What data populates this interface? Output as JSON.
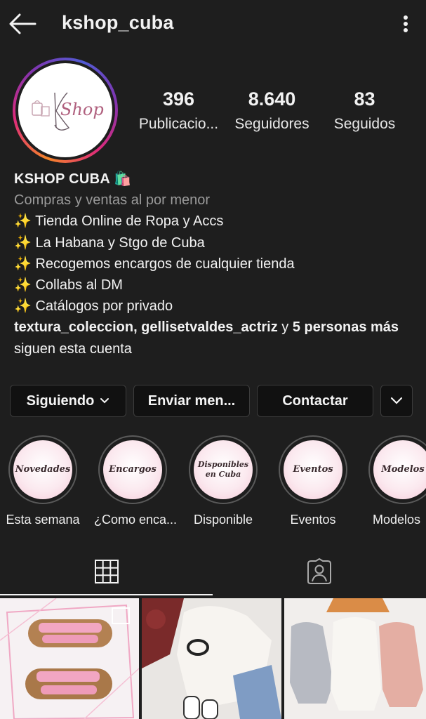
{
  "header": {
    "username": "kshop_cuba",
    "back_icon": "arrow-left-icon",
    "more_icon": "kebab-menu-icon"
  },
  "profile": {
    "avatar_text": "Shop",
    "stats": [
      {
        "value": "396",
        "label": "Publicacio..."
      },
      {
        "value": "8.640",
        "label": "Seguidores"
      },
      {
        "value": "83",
        "label": "Seguidos"
      }
    ]
  },
  "bio": {
    "name": "KSHOP CUBA 🛍️",
    "category": "Compras y ventas al por menor",
    "lines": [
      "✨ Tienda Online de Ropa y Accs",
      "✨ La Habana y Stgo de Cuba",
      "✨ Recogemos encargos de cualquier tienda",
      "✨ Collabs al DM",
      "✨ Catálogos por privado"
    ],
    "followed_by_bold": "textura_coleccion, gellisetvaldes_actriz",
    "followed_by_and": " y ",
    "followed_by_more": "5 personas más",
    "followed_by_tail": " siguen esta cuenta"
  },
  "buttons": {
    "following": "Siguiendo",
    "message": "Enviar men...",
    "contact": "Contactar",
    "chevron_icon": "chevron-down-icon"
  },
  "highlights": [
    {
      "cover": "Novedades",
      "label": "Esta semana"
    },
    {
      "cover": "Encargos",
      "label": "¿Como enca..."
    },
    {
      "cover": "Disponibles en Cuba",
      "label": "Disponible"
    },
    {
      "cover": "Eventos",
      "label": "Eventos"
    },
    {
      "cover": "Modelos",
      "label": "Modelos"
    }
  ],
  "tabs": [
    {
      "icon": "grid-icon",
      "active": true
    },
    {
      "icon": "tagged-person-icon",
      "active": false
    }
  ],
  "colors": {
    "background": "#1e1e1e",
    "text": "#f2f2f2",
    "muted": "#9a9a9a",
    "button_bg": "#111111",
    "button_border": "#3c3c3c"
  }
}
